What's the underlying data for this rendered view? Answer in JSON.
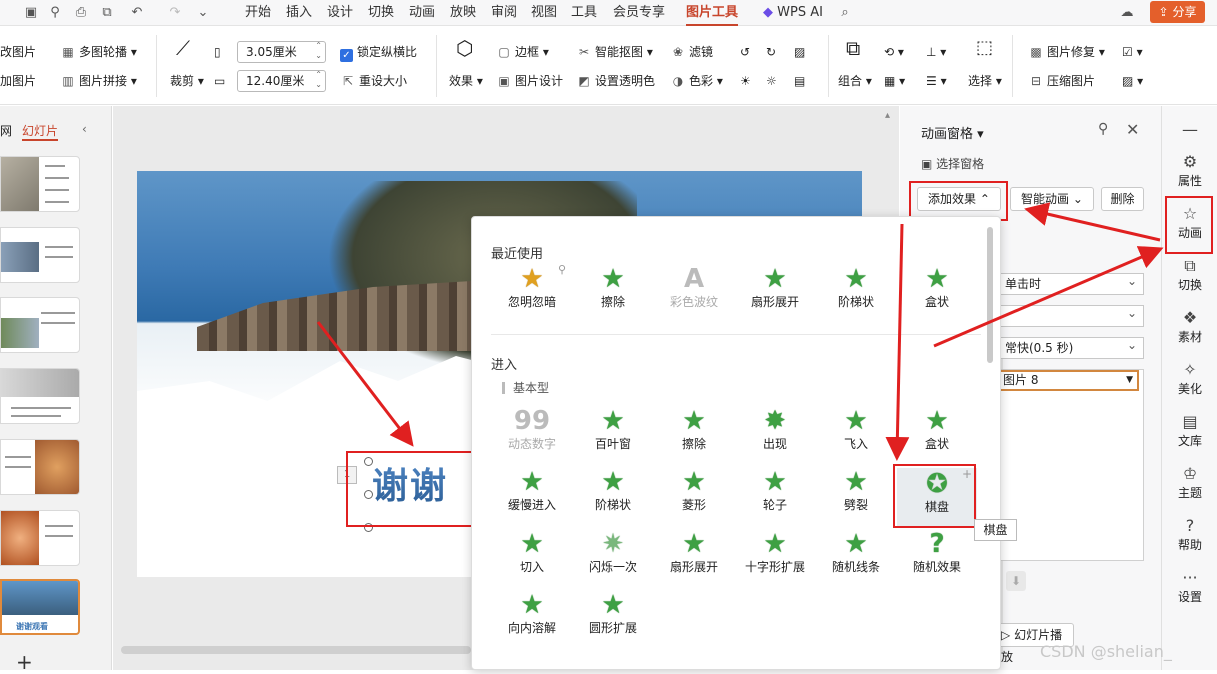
{
  "menu": {
    "tabs": [
      "开始",
      "插入",
      "设计",
      "切换",
      "动画",
      "放映",
      "审阅",
      "视图",
      "工具",
      "会员专享",
      "图片工具"
    ],
    "active_tab": "图片工具",
    "wps_ai": "WPS AI",
    "share": "分享"
  },
  "ribbon": {
    "b_left1": "改图片",
    "b_left2": "加图片",
    "multi_contour": "多图轮播",
    "picture_stitch": "图片拼接",
    "crop": "裁剪",
    "height_value": "3.05厘米",
    "width_value": "12.40厘米",
    "lock_ratio": "锁定纵横比",
    "reset_size": "重设大小",
    "effects": "效果",
    "border": "边框",
    "picture_design": "图片设计",
    "smart_cutout": "智能抠图",
    "set_transparent": "设置透明色",
    "filter": "滤镜",
    "color": "色彩",
    "combine": "组合",
    "select": "选择",
    "picture_repair": "图片修复",
    "compress": "压缩图片"
  },
  "left_panel": {
    "tab_outline": "网",
    "tab_slides": "幻灯片",
    "current_slide_caption": "谢谢观看"
  },
  "slide": {
    "title_text": "谢谢",
    "number_tag": "1"
  },
  "right_panel": {
    "title": "动画窗格",
    "select_pane": "选择窗格",
    "add_effect": "添加效果",
    "smart_animation": "智能动画",
    "delete": "删除",
    "trigger_value": "单击时",
    "speed_value": "非常快(0.5 秒)",
    "speed_display": "常快(0.5 秒)",
    "list_item": "图片 8",
    "list_item_display": "图片 8",
    "play_button": "幻灯片播放"
  },
  "vtabs": [
    "属性",
    "动画",
    "切换",
    "素材",
    "美化",
    "文库",
    "主题",
    "帮助",
    "设置"
  ],
  "popup": {
    "recent_title": "最近使用",
    "recent": [
      "忽明忽暗",
      "擦除",
      "彩色波纹",
      "扇形展开",
      "阶梯状",
      "盒状"
    ],
    "enter_title": "进入",
    "basic_title": "基本型",
    "row1": [
      "动态数字",
      "百叶窗",
      "擦除",
      "出现",
      "飞入",
      "盒状"
    ],
    "row2": [
      "缓慢进入",
      "阶梯状",
      "菱形",
      "轮子",
      "劈裂",
      "棋盘"
    ],
    "row3": [
      "切入",
      "闪烁一次",
      "扇形展开",
      "十字形扩展",
      "随机线条",
      "随机效果"
    ],
    "row4": [
      "向内溶解",
      "圆形扩展"
    ]
  },
  "tooltip": "棋盘",
  "watermark": "CSDN @shelian_",
  "colors": {
    "accent": "#c8452c",
    "star": "#3ea043",
    "highlight": "#e02020"
  }
}
